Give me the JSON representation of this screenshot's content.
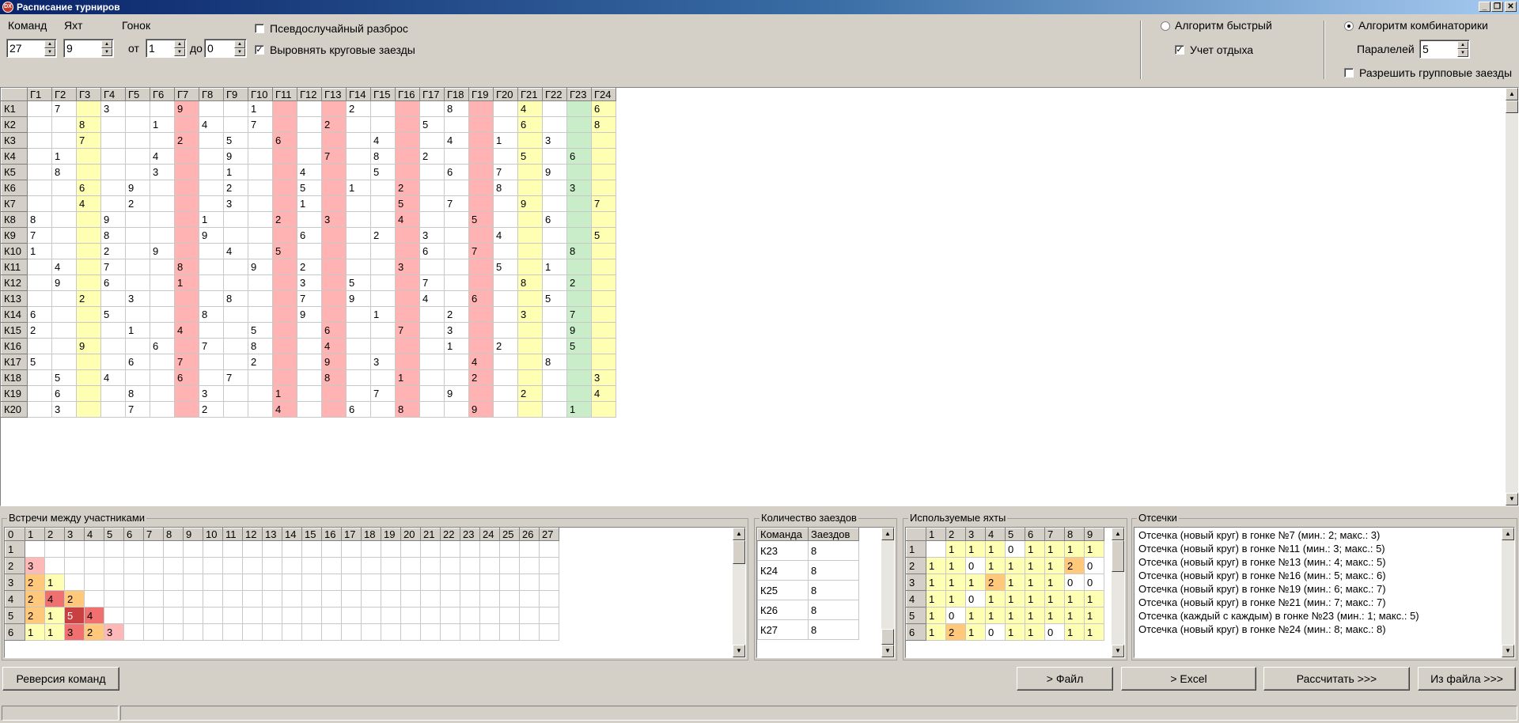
{
  "window": {
    "title": "Расписание турниров"
  },
  "controls": {
    "teams_label": "Команд",
    "teams_value": "27",
    "yachts_label": "Яхт",
    "yachts_value": "9",
    "races_label": "Гонок",
    "from_label": "от",
    "from_value": "1",
    "to_label": "до",
    "to_value": "0",
    "pseudo_random_label": "Псевдослучайный разброс",
    "pseudo_random_checked": false,
    "align_rounds_label": "Выровнять круговые заезды",
    "align_rounds_checked": true,
    "algo_fast_label": "Алгоритм быстрый",
    "algo_fast_selected": false,
    "rest_label": "Учет отдыха",
    "rest_checked": true,
    "algo_comb_label": "Алгоритм комбинаторики",
    "algo_comb_selected": true,
    "parallel_label": "Паралелей",
    "parallel_value": "5",
    "group_races_label": "Разрешить групповые заезды",
    "group_races_checked": false
  },
  "schedule": {
    "columns": [
      "Г1",
      "Г2",
      "Г3",
      "Г4",
      "Г5",
      "Г6",
      "Г7",
      "Г8",
      "Г9",
      "Г10",
      "Г11",
      "Г12",
      "Г13",
      "Г14",
      "Г15",
      "Г16",
      "Г17",
      "Г18",
      "Г19",
      "Г20",
      "Г21",
      "Г22",
      "Г23",
      "Г24"
    ],
    "column_colors": [
      "",
      "",
      "y",
      "",
      "",
      "",
      "r",
      "",
      "",
      "",
      "r",
      "",
      "r",
      "",
      "",
      "r",
      "",
      "",
      "r",
      "",
      "y",
      "",
      "g",
      "y"
    ],
    "rows": [
      {
        "label": "К1",
        "cells": [
          "",
          "7",
          "",
          "3",
          "",
          "",
          "9",
          "",
          "",
          "1",
          "",
          "",
          "",
          "2",
          "",
          "",
          "",
          "8",
          "",
          "",
          "4",
          "",
          "",
          "6"
        ]
      },
      {
        "label": "К2",
        "cells": [
          "",
          "",
          "8",
          "",
          "",
          "1",
          "",
          "4",
          "",
          "7",
          "",
          "",
          "2",
          "",
          "",
          "",
          "5",
          "",
          "",
          "",
          "6",
          "",
          "",
          "8"
        ]
      },
      {
        "label": "К3",
        "cells": [
          "",
          "",
          "7",
          "",
          "",
          "",
          "2",
          "",
          "5",
          "",
          "6",
          "",
          "",
          "",
          "4",
          "",
          "",
          "4",
          "",
          "1",
          "",
          "3",
          "",
          ""
        ]
      },
      {
        "label": "К4",
        "cells": [
          "",
          "1",
          "",
          "",
          "",
          "4",
          "",
          "",
          "9",
          "",
          "",
          "",
          "7",
          "",
          "8",
          "",
          "2",
          "",
          "",
          "",
          "5",
          "",
          "6",
          ""
        ]
      },
      {
        "label": "К5",
        "cells": [
          "",
          "8",
          "",
          "",
          "",
          "3",
          "",
          "",
          "1",
          "",
          "",
          "4",
          "",
          "",
          "5",
          "",
          "",
          "6",
          "",
          "7",
          "",
          "9",
          "",
          ""
        ]
      },
      {
        "label": "К6",
        "cells": [
          "",
          "",
          "6",
          "",
          "9",
          "",
          "",
          "",
          "2",
          "",
          "",
          "5",
          "",
          "1",
          "",
          "2",
          "",
          "",
          "",
          "8",
          "",
          "",
          "3",
          ""
        ]
      },
      {
        "label": "К7",
        "cells": [
          "",
          "",
          "4",
          "",
          "2",
          "",
          "",
          "",
          "3",
          "",
          "",
          "1",
          "",
          "",
          "",
          "5",
          "",
          "7",
          "",
          "",
          "9",
          "",
          "",
          "7"
        ]
      },
      {
        "label": "К8",
        "cells": [
          "8",
          "",
          "",
          "9",
          "",
          "",
          "",
          "1",
          "",
          "",
          "2",
          "",
          "3",
          "",
          "",
          "4",
          "",
          "",
          "5",
          "",
          "",
          "6",
          "",
          ""
        ]
      },
      {
        "label": "К9",
        "cells": [
          "7",
          "",
          "",
          "8",
          "",
          "",
          "",
          "9",
          "",
          "",
          "",
          "6",
          "",
          "",
          "2",
          "",
          "3",
          "",
          "",
          "4",
          "",
          "",
          "",
          "5"
        ]
      },
      {
        "label": "К10",
        "cells": [
          "1",
          "",
          "",
          "2",
          "",
          "9",
          "",
          "",
          "4",
          "",
          "5",
          "",
          "",
          "",
          "",
          "",
          "6",
          "",
          "7",
          "",
          "",
          "",
          "8",
          ""
        ]
      },
      {
        "label": "К11",
        "cells": [
          "",
          "4",
          "",
          "7",
          "",
          "",
          "8",
          "",
          "",
          "9",
          "",
          "2",
          "",
          "",
          "",
          "3",
          "",
          "",
          "",
          "5",
          "",
          "1",
          "",
          ""
        ]
      },
      {
        "label": "К12",
        "cells": [
          "",
          "9",
          "",
          "6",
          "",
          "",
          "1",
          "",
          "",
          "",
          "",
          "3",
          "",
          "5",
          "",
          "",
          "7",
          "",
          "",
          "",
          "8",
          "",
          "2",
          ""
        ]
      },
      {
        "label": "К13",
        "cells": [
          "",
          "",
          "2",
          "",
          "3",
          "",
          "",
          "",
          "8",
          "",
          "",
          "7",
          "",
          "9",
          "",
          "",
          "4",
          "",
          "6",
          "",
          "",
          "5",
          "",
          ""
        ]
      },
      {
        "label": "К14",
        "cells": [
          "6",
          "",
          "",
          "5",
          "",
          "",
          "",
          "8",
          "",
          "",
          "",
          "9",
          "",
          "",
          "1",
          "",
          "",
          "2",
          "",
          "",
          "3",
          "",
          "7",
          ""
        ]
      },
      {
        "label": "К15",
        "cells": [
          "2",
          "",
          "",
          "",
          "1",
          "",
          "4",
          "",
          "",
          "5",
          "",
          "",
          "6",
          "",
          "",
          "7",
          "",
          "3",
          "",
          "",
          "",
          "",
          "9",
          ""
        ]
      },
      {
        "label": "К16",
        "cells": [
          "",
          "",
          "9",
          "",
          "",
          "6",
          "",
          "7",
          "",
          "8",
          "",
          "",
          "4",
          "",
          "",
          "",
          "",
          "1",
          "",
          "2",
          "",
          "",
          "5",
          ""
        ]
      },
      {
        "label": "К17",
        "cells": [
          "5",
          "",
          "",
          "",
          "6",
          "",
          "7",
          "",
          "",
          "2",
          "",
          "",
          "9",
          "",
          "3",
          "",
          "",
          "",
          "4",
          "",
          "",
          "8",
          "",
          ""
        ]
      },
      {
        "label": "К18",
        "cells": [
          "",
          "5",
          "",
          "4",
          "",
          "",
          "6",
          "",
          "7",
          "",
          "",
          "",
          "8",
          "",
          "",
          "1",
          "",
          "",
          "2",
          "",
          "",
          "",
          "",
          "3"
        ]
      },
      {
        "label": "К19",
        "cells": [
          "",
          "6",
          "",
          "",
          "8",
          "",
          "",
          "3",
          "",
          "",
          "1",
          "",
          "",
          "",
          "7",
          "",
          "",
          "9",
          "",
          "",
          "2",
          "",
          "",
          "4"
        ]
      },
      {
        "label": "К20",
        "cells": [
          "",
          "3",
          "",
          "",
          "7",
          "",
          "",
          "2",
          "",
          "",
          "4",
          "",
          "",
          "6",
          "",
          "8",
          "",
          "",
          "9",
          "",
          "",
          "",
          "1",
          ""
        ]
      }
    ]
  },
  "meetings": {
    "title": "Встречи между участниками",
    "header": [
      "0",
      "1",
      "2",
      "3",
      "4",
      "5",
      "6",
      "7",
      "8",
      "9",
      "10",
      "11",
      "12",
      "13",
      "14",
      "15",
      "16",
      "17",
      "18",
      "19",
      "20",
      "21",
      "22",
      "23",
      "24",
      "25",
      "26",
      "27"
    ],
    "rows": [
      {
        "label": "1",
        "cells": []
      },
      {
        "label": "2",
        "cells": [
          "3"
        ],
        "colors": [
          "p"
        ]
      },
      {
        "label": "3",
        "cells": [
          "2",
          "1"
        ],
        "colors": [
          "o",
          "y"
        ]
      },
      {
        "label": "4",
        "cells": [
          "2",
          "4",
          "2"
        ],
        "colors": [
          "o",
          "r",
          "o"
        ]
      },
      {
        "label": "5",
        "cells": [
          "2",
          "1",
          "5",
          "4"
        ],
        "colors": [
          "o",
          "y",
          "dr",
          "r"
        ]
      },
      {
        "label": "6",
        "cells": [
          "1",
          "1",
          "3",
          "2",
          "3"
        ],
        "colors": [
          "y",
          "y",
          "r",
          "o",
          "p"
        ]
      }
    ]
  },
  "race_count": {
    "title": "Количество заездов",
    "headers": [
      "Команда",
      "Заездов"
    ],
    "rows": [
      [
        "К23",
        "8"
      ],
      [
        "К24",
        "8"
      ],
      [
        "К25",
        "8"
      ],
      [
        "К26",
        "8"
      ],
      [
        "К27",
        "8"
      ]
    ]
  },
  "yachts_used": {
    "title": "Используемые яхты",
    "header": [
      "",
      "1",
      "2",
      "3",
      "4",
      "5",
      "6",
      "7",
      "8",
      "9"
    ],
    "rows": [
      {
        "label": "1",
        "cells": [
          "",
          "1",
          "1",
          "1",
          "0",
          "1",
          "1",
          "1",
          "1"
        ],
        "colors": [
          "",
          "y",
          "y",
          "y",
          "g",
          "y",
          "y",
          "y",
          "y"
        ]
      },
      {
        "label": "2",
        "cells": [
          "1",
          "1",
          "0",
          "1",
          "1",
          "1",
          "1",
          "2",
          "0"
        ],
        "colors": [
          "y",
          "y",
          "g",
          "y",
          "y",
          "y",
          "y",
          "o",
          "g"
        ]
      },
      {
        "label": "3",
        "cells": [
          "1",
          "1",
          "1",
          "2",
          "1",
          "1",
          "1",
          "0",
          "0"
        ],
        "colors": [
          "y",
          "y",
          "y",
          "o",
          "y",
          "y",
          "y",
          "g",
          "g"
        ]
      },
      {
        "label": "4",
        "cells": [
          "1",
          "1",
          "0",
          "1",
          "1",
          "1",
          "1",
          "1",
          "1"
        ],
        "colors": [
          "y",
          "y",
          "g",
          "y",
          "y",
          "y",
          "y",
          "y",
          "y"
        ]
      },
      {
        "label": "5",
        "cells": [
          "1",
          "0",
          "1",
          "1",
          "1",
          "1",
          "1",
          "1",
          "1"
        ],
        "colors": [
          "y",
          "g",
          "y",
          "y",
          "y",
          "y",
          "y",
          "y",
          "y"
        ]
      },
      {
        "label": "6",
        "cells": [
          "1",
          "2",
          "1",
          "0",
          "1",
          "1",
          "0",
          "1",
          "1"
        ],
        "colors": [
          "y",
          "o",
          "y",
          "g",
          "y",
          "y",
          "g",
          "y",
          "y"
        ]
      }
    ]
  },
  "cutoffs": {
    "title": "Отсечки",
    "lines": [
      "Отсечка (новый круг) в гонке №7 (мин.: 2; макс.: 3)",
      "Отсечка (новый круг) в гонке №11 (мин.: 3; макс.: 5)",
      "Отсечка (новый круг) в гонке №13 (мин.: 4; макс.: 5)",
      "Отсечка (новый круг) в гонке №16 (мин.: 5; макс.: 6)",
      "Отсечка (новый круг) в гонке №19 (мин.: 6; макс.: 7)",
      "Отсечка (новый круг) в гонке №21 (мин.: 7; макс.: 7)",
      "Отсечка (каждый с каждым) в гонке №23 (мин.: 1; макс.: 5)",
      "Отсечка (новый круг) в гонке №24 (мин.: 8; макс.: 8)"
    ]
  },
  "buttons": {
    "reverse": "Реверсия команд",
    "to_file": "> Файл",
    "to_excel": "> Excel",
    "calculate": "Рассчитать >>>",
    "from_file": "Из файла >>>"
  },
  "colors": {
    "yellow": "#ffffb3",
    "red": "#ffb3b3",
    "green": "#c8edc8",
    "orange": "#ffc87a"
  }
}
